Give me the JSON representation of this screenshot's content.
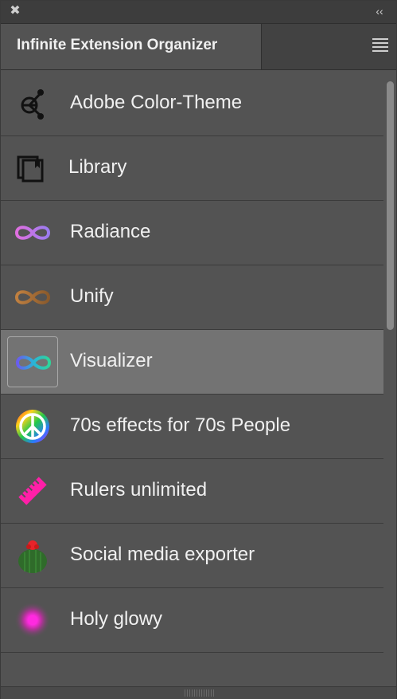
{
  "window": {
    "close_glyph": "✖",
    "collapse_glyph": "‹‹"
  },
  "panel": {
    "tab_title": "Infinite Extension Organizer"
  },
  "items": [
    {
      "label": "Adobe Color-Theme",
      "icon": "color-theme-icon"
    },
    {
      "label": "Library",
      "icon": "library-icon"
    },
    {
      "label": "Radiance",
      "icon": "infinity-purple-icon"
    },
    {
      "label": "Unify",
      "icon": "infinity-bronze-icon"
    },
    {
      "label": "Visualizer",
      "icon": "infinity-gradient-icon",
      "selected": true
    },
    {
      "label": "70s effects for 70s People",
      "icon": "peace-sign-icon"
    },
    {
      "label": "Rulers unlimited",
      "icon": "ruler-icon"
    },
    {
      "label": "Social media exporter",
      "icon": "cactus-icon"
    },
    {
      "label": "Holy glowy",
      "icon": "glow-orb-icon"
    }
  ],
  "colors": {
    "panel_bg": "#535353",
    "selected_row": "#737373",
    "titlebar": "#3d3d3d"
  }
}
